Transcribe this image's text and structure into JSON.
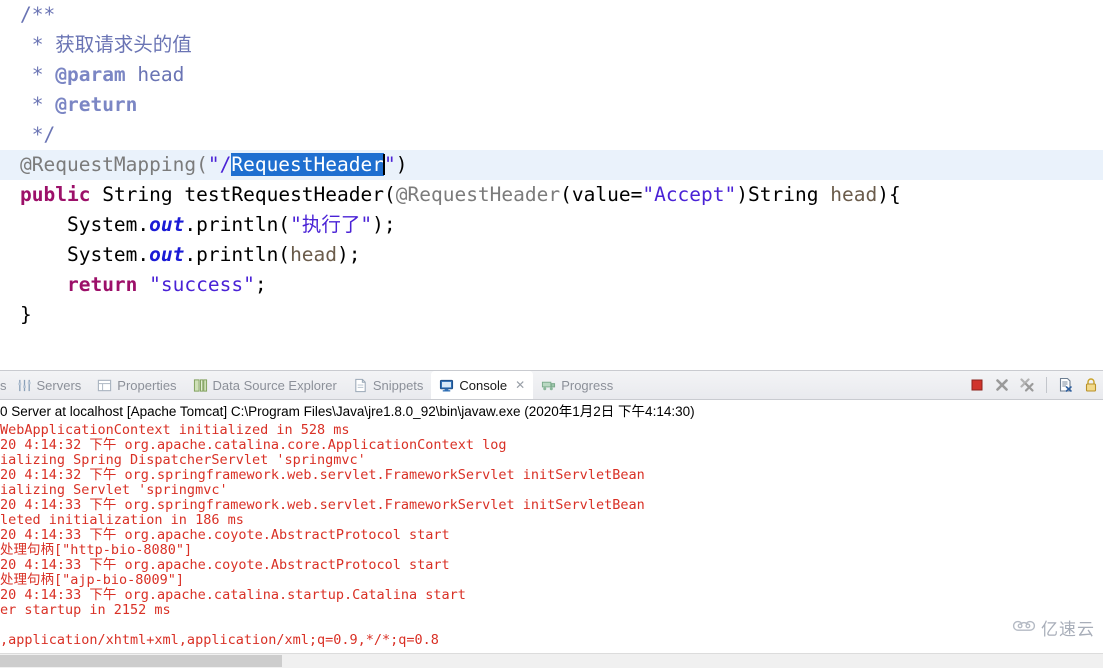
{
  "editor": {
    "lines": [
      {
        "id": "l1",
        "text": "/**"
      },
      {
        "id": "l2",
        "text": " * 获取请求头的值"
      },
      {
        "id": "l3",
        "at": " * ",
        "text": "@param",
        "tail": " head"
      },
      {
        "id": "l4",
        "at": " * ",
        "text": "@return"
      },
      {
        "id": "l5",
        "text": " */"
      },
      {
        "id": "l6",
        "text": "@RequestMapping(\"/RequestHeader\")"
      },
      {
        "id": "l7",
        "text": "public String testRequestHeader(@RequestHeader(value=\"Accept\")String head){"
      },
      {
        "id": "l8",
        "text": "    System.out.println(\"执行了\");"
      },
      {
        "id": "l9",
        "text": "    System.out.println(head);"
      },
      {
        "id": "l10",
        "text": "    return \"success\";"
      },
      {
        "id": "l11",
        "text": "}"
      }
    ],
    "tokens": {
      "comment_open": "/**",
      "comment_star": " * ",
      "comment_cn": "获取请求头的值",
      "tag_param": "@param",
      "param_name": " head",
      "tag_return": "@return",
      "comment_close": " */",
      "anno_requestmapping": "@RequestMapping(",
      "str_quote": "\"",
      "path_slash": "/",
      "selected_text": "RequestHeader",
      "paren_close": ")",
      "kw_public": "public",
      "type_string": "String",
      "method_name": "testRequestHeader",
      "anno_requestheader": "@RequestHeader",
      "attr_value": "value=",
      "str_accept": "Accept",
      "type_string2": "String",
      "arg_head": "head",
      "brace_open": "){",
      "system": "System.",
      "out_field": "out",
      "println": ".println(",
      "str_cn_exec": "执行了",
      "stmt_end": ");",
      "head_ref": "head",
      "kw_return": "return",
      "str_success": "success",
      "semicolon": ";",
      "brace_close": "}"
    },
    "selection_color": "#1f6fd0",
    "highlight_row_color": "#eaf2fb"
  },
  "panel": {
    "tabs": [
      {
        "name": "tab-clipped",
        "label": "s",
        "icon": "clipped-tab-icon",
        "active": false,
        "clipped": true
      },
      {
        "name": "tab-servers",
        "label": "Servers",
        "icon": "servers-icon",
        "active": false
      },
      {
        "name": "tab-properties",
        "label": "Properties",
        "icon": "properties-icon",
        "active": false
      },
      {
        "name": "tab-data-source-explorer",
        "label": "Data Source Explorer",
        "icon": "data-source-icon",
        "active": false
      },
      {
        "name": "tab-snippets",
        "label": "Snippets",
        "icon": "snippets-icon",
        "active": false
      },
      {
        "name": "tab-console",
        "label": "Console",
        "icon": "console-icon",
        "active": true,
        "close": "✕"
      },
      {
        "name": "tab-progress",
        "label": "Progress",
        "icon": "progress-icon",
        "active": false
      }
    ],
    "toolbar": [
      {
        "name": "terminate-button",
        "icon": "stop-square-icon",
        "title": "Terminate"
      },
      {
        "name": "remove-launch-button",
        "icon": "remove-x-icon",
        "title": "Remove Launch"
      },
      {
        "name": "remove-all-launches-button",
        "icon": "remove-all-x-icon",
        "title": "Remove All Terminated Launches"
      },
      {
        "name": "clear-console-button",
        "icon": "clear-console-icon",
        "title": "Clear Console"
      },
      {
        "name": "scroll-lock-button",
        "icon": "scroll-lock-icon",
        "title": "Scroll Lock"
      }
    ],
    "console": {
      "header": "0 Server at localhost [Apache Tomcat] C:\\Program Files\\Java\\jre1.8.0_92\\bin\\javaw.exe (2020年1月2日 下午4:14:30)",
      "text_color": "#d93025",
      "lines": [
        "WebApplicationContext initialized in 528 ms",
        "20 4:14:32 下午 org.apache.catalina.core.ApplicationContext log",
        "ializing Spring DispatcherServlet 'springmvc'",
        "20 4:14:32 下午 org.springframework.web.servlet.FrameworkServlet initServletBean",
        "ializing Servlet 'springmvc'",
        "20 4:14:33 下午 org.springframework.web.servlet.FrameworkServlet initServletBean",
        "leted initialization in 186 ms",
        "20 4:14:33 下午 org.apache.coyote.AbstractProtocol start",
        "处理句柄[\"http-bio-8080\"]",
        "20 4:14:33 下午 org.apache.coyote.AbstractProtocol start",
        "处理句柄[\"ajp-bio-8009\"]",
        "20 4:14:33 下午 org.apache.catalina.startup.Catalina start",
        "er startup in 2152 ms",
        "",
        ",application/xhtml+xml,application/xml;q=0.9,*/*;q=0.8"
      ]
    },
    "scrollbar": {
      "name": "horizontal-scrollbar"
    }
  },
  "watermark": {
    "text": "亿速云"
  }
}
